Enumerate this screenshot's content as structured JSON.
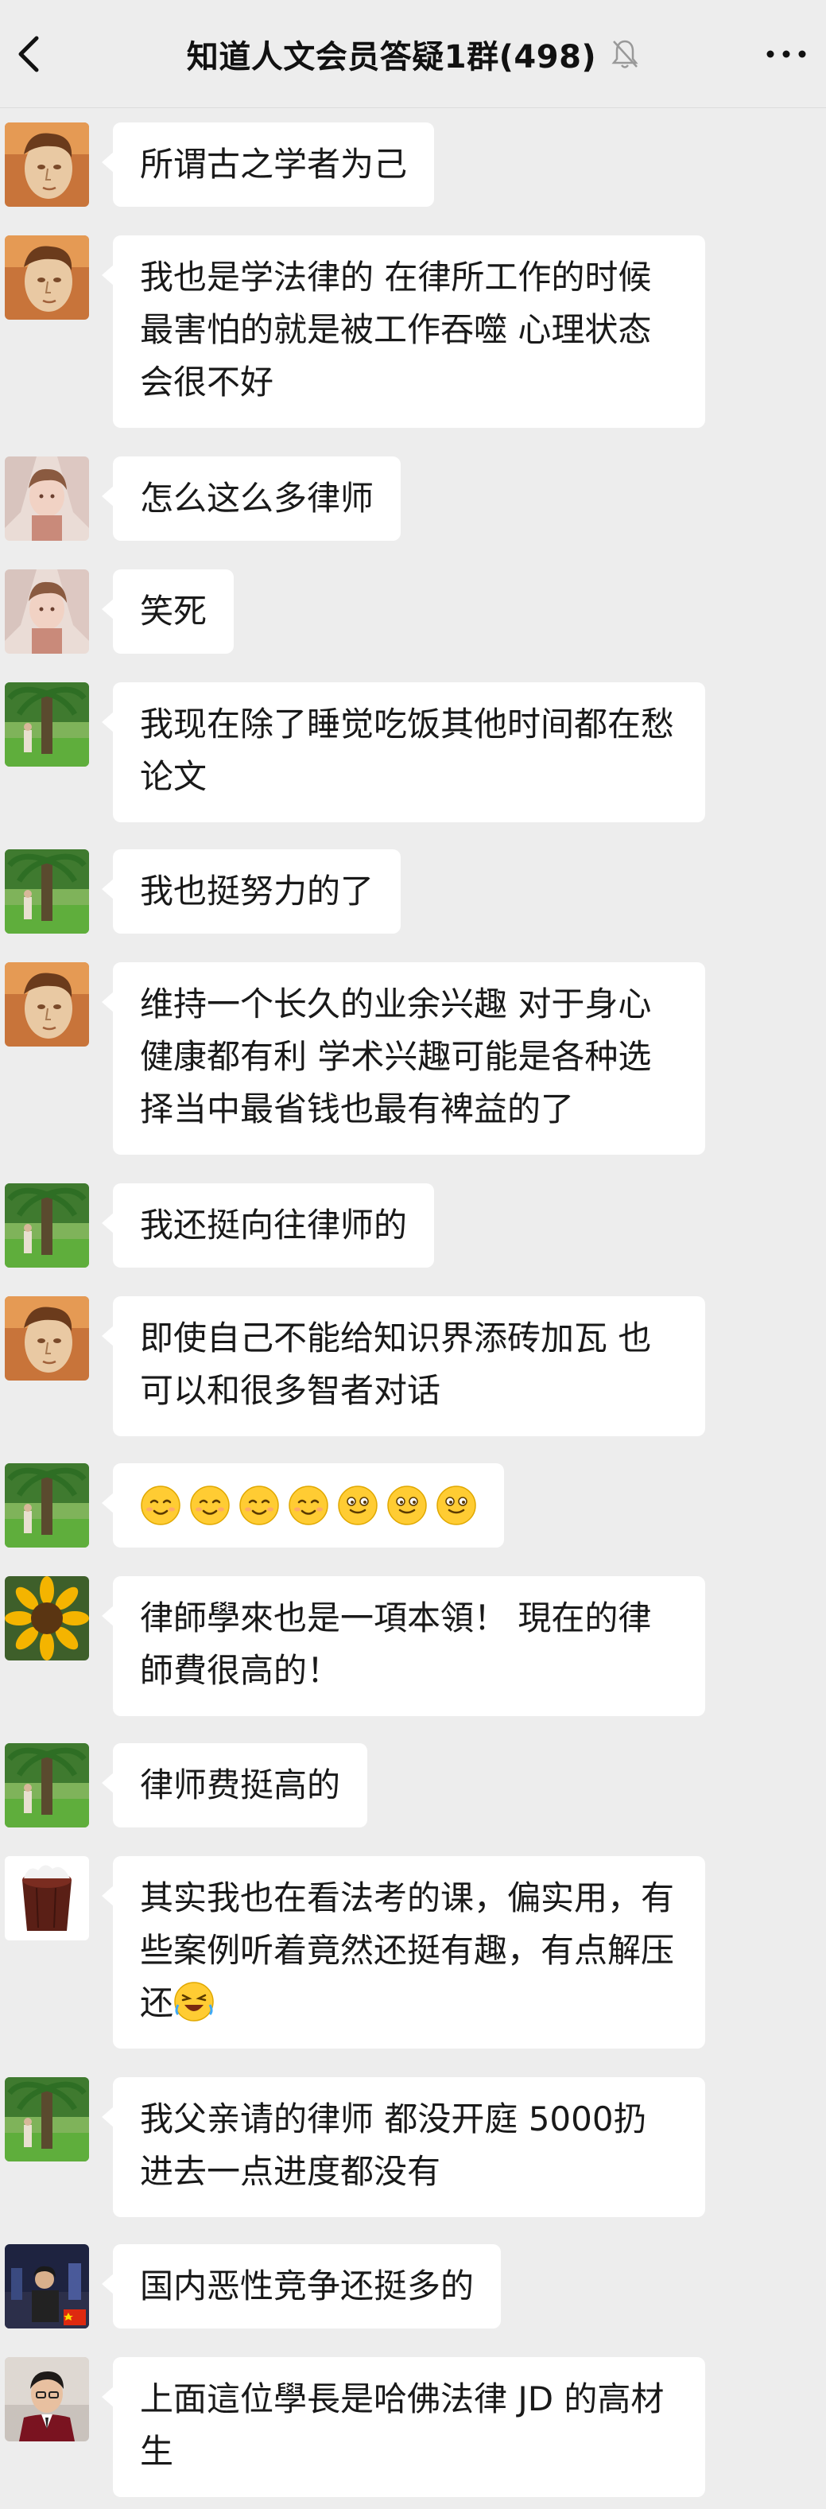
{
  "header": {
    "title": "知道人文会员答疑1群(498)",
    "back_icon": "chevron-left-icon",
    "mute_icon": "bell-muted-icon",
    "more_icon": "more-horizontal-icon"
  },
  "messages": [
    {
      "avatar": "david-statue-avatar",
      "text": "所谓古之学者为己"
    },
    {
      "avatar": "david-statue-avatar",
      "text": "我也是学法律的 在律所工作的时候 最害怕的就是被工作吞噬 心理状态会很不好"
    },
    {
      "avatar": "angel-painting-avatar",
      "text": "怎么这么多律师"
    },
    {
      "avatar": "angel-painting-avatar",
      "text": "笑死"
    },
    {
      "avatar": "palm-tree-avatar",
      "text": "我现在除了睡觉吃饭其他时间都在愁论文"
    },
    {
      "avatar": "palm-tree-avatar",
      "text": "我也挺努力的了"
    },
    {
      "avatar": "david-statue-avatar",
      "text": "维持一个长久的业余兴趣 对于身心健康都有利 学术兴趣可能是各种选择当中最省钱也最有裨益的了"
    },
    {
      "avatar": "palm-tree-avatar",
      "text": "我还挺向往律师的"
    },
    {
      "avatar": "david-statue-avatar",
      "text": "即使自己不能给知识界添砖加瓦 也可以和很多智者对话"
    },
    {
      "avatar": "palm-tree-avatar",
      "emojis": [
        "smile",
        "smile",
        "smile",
        "smile",
        "grin",
        "grin",
        "grin"
      ]
    },
    {
      "avatar": "sunflower-avatar",
      "text": "律師學來也是一項本領！ 現在的律師費很高的！"
    },
    {
      "avatar": "palm-tree-avatar",
      "text": "律师费挺高的"
    },
    {
      "avatar": "cake-avatar",
      "text": "其实我也在看法考的课，偏实用，有些案例听着竟然还挺有趣，有点解压还",
      "trailing_emoji": "rofl"
    },
    {
      "avatar": "palm-tree-avatar",
      "text": "我父亲请的律师 都没开庭 5000扔进去一点进度都没有"
    },
    {
      "avatar": "city-photo-avatar",
      "text": "国内恶性竞争还挺多的"
    },
    {
      "avatar": "man-portrait-avatar",
      "text": "上面這位學長是哈佛法律 JD 的高材生"
    }
  ]
}
